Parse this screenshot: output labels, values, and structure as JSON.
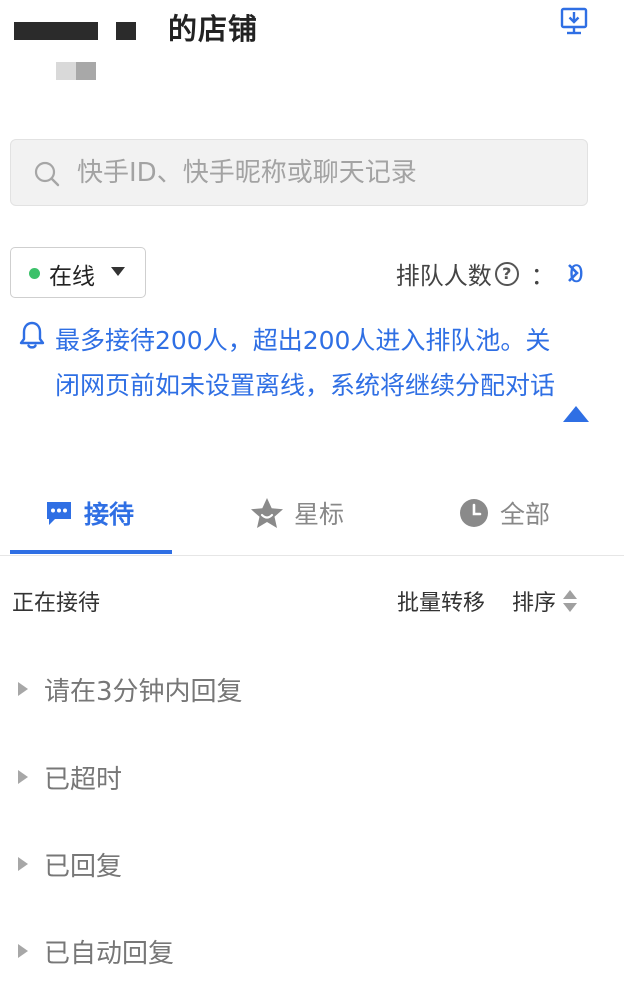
{
  "header": {
    "shop_suffix": "的店铺",
    "download_icon": "download-desktop-icon"
  },
  "search": {
    "placeholder": "快手ID、快手昵称或聊天记录"
  },
  "status": {
    "value": "在线",
    "dot_color": "#3cc16a"
  },
  "queue": {
    "label": "排队人数",
    "colon": "：",
    "count": "0"
  },
  "notice": {
    "text": "最多接待200人，超出200人进入排队池。关闭网页前如未设置离线，系统将继续分配对话"
  },
  "tabs": [
    {
      "label": "接待",
      "icon": "chat-bubble-icon",
      "active": true
    },
    {
      "label": "星标",
      "icon": "star-icon",
      "active": false
    },
    {
      "label": "全部",
      "icon": "clock-icon",
      "active": false
    }
  ],
  "section": {
    "title": "正在接待",
    "batch_transfer": "批量转移",
    "sort": "排序"
  },
  "groups": [
    {
      "label": "请在3分钟内回复"
    },
    {
      "label": "已超时"
    },
    {
      "label": "已回复"
    },
    {
      "label": "已自动回复"
    }
  ],
  "colors": {
    "accent": "#2f6fe4",
    "online": "#3cc16a",
    "muted": "#888888"
  }
}
